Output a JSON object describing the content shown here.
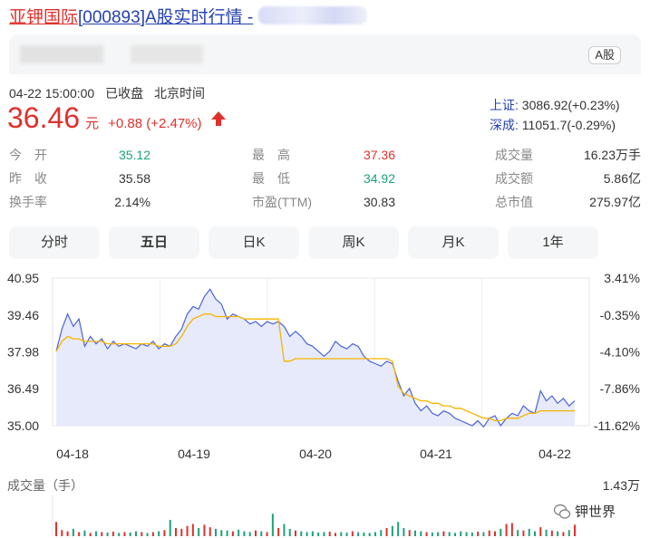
{
  "title": {
    "name": "亚钾国际",
    "rest": "[000893]A股实时行情 -"
  },
  "header": {
    "badge": "A股"
  },
  "status": {
    "datetime": "04-22 15:00:00",
    "state": "已收盘",
    "tz": "北京时间"
  },
  "price": {
    "current": "36.46",
    "unit": "元",
    "change": "+0.88 (+2.47%)"
  },
  "indexes": [
    {
      "label": "上证:",
      "value": "3086.92(+0.23%)"
    },
    {
      "label": "深成:",
      "value": "11051.7(-0.29%)"
    }
  ],
  "stats": [
    [
      {
        "label": "今　开",
        "value": "35.12",
        "color": "#1aa37a"
      },
      {
        "label": "最　高",
        "value": "37.36",
        "color": "#e0302c"
      },
      {
        "label": "成交量",
        "value": "16.23万手",
        "color": "#333333"
      }
    ],
    [
      {
        "label": "昨　收",
        "value": "35.58",
        "color": "#333333"
      },
      {
        "label": "最　低",
        "value": "34.92",
        "color": "#1aa37a"
      },
      {
        "label": "成交额",
        "value": "5.86亿",
        "color": "#333333"
      }
    ],
    [
      {
        "label": "换手率",
        "value": "2.14%",
        "color": "#333333"
      },
      {
        "label": "市盈(TTM)",
        "value": "30.83",
        "color": "#333333"
      },
      {
        "label": "总市值",
        "value": "275.97亿",
        "color": "#333333"
      }
    ]
  ],
  "tabs": [
    "分时",
    "五日",
    "日K",
    "周K",
    "月K",
    "1年"
  ],
  "active_tab": 1,
  "chart_data": {
    "type": "line",
    "y_ticks": [
      "40.95",
      "39.46",
      "37.98",
      "36.49",
      "35.00"
    ],
    "y_tick_values": [
      40.95,
      39.46,
      37.98,
      36.49,
      35.0
    ],
    "pct_ticks": [
      "3.41%",
      "-0.35%",
      "-4.10%",
      "-7.86%",
      "-11.62%"
    ],
    "x_ticks": [
      "04-18",
      "04-19",
      "04-20",
      "04-21",
      "04-22"
    ],
    "ylim": [
      35.0,
      40.95
    ],
    "series": [
      {
        "values": [
          38.0,
          38.9,
          39.5,
          39.0,
          39.3,
          38.2,
          38.6,
          38.3,
          38.5,
          38.1,
          38.4,
          38.2,
          38.3,
          38.2,
          38.1,
          38.3,
          38.2,
          38.4,
          38.1,
          38.3,
          38.2,
          38.6,
          38.9,
          39.5,
          39.8,
          39.7,
          40.2,
          40.5,
          40.1,
          39.9,
          39.3,
          39.5,
          39.4,
          39.3,
          39.1,
          39.2,
          39.0,
          39.2,
          39.1,
          39.2,
          39.0,
          38.6,
          38.8,
          38.6,
          38.3,
          38.2,
          38.0,
          37.8,
          38.0,
          38.4,
          38.2,
          38.1,
          38.3,
          38.2,
          37.8,
          37.6,
          37.5,
          37.4,
          37.6,
          37.5,
          36.8,
          36.2,
          36.5,
          35.9,
          35.6,
          35.8,
          35.5,
          35.4,
          35.6,
          35.5,
          35.3,
          35.2,
          35.1,
          35.0,
          35.2,
          34.95,
          35.3,
          35.4,
          35.0,
          35.3,
          35.5,
          35.4,
          35.8,
          35.6,
          35.5,
          36.4,
          36.0,
          36.2,
          35.9,
          36.1,
          35.8,
          36.0
        ]
      },
      {
        "values": [
          38.0,
          38.4,
          38.6,
          38.5,
          38.5,
          38.4,
          38.4,
          38.4,
          38.4,
          38.3,
          38.3,
          38.3,
          38.3,
          38.3,
          38.3,
          38.3,
          38.3,
          38.3,
          38.2,
          38.2,
          38.2,
          38.3,
          38.6,
          39.0,
          39.3,
          39.4,
          39.5,
          39.5,
          39.4,
          39.4,
          39.4,
          39.4,
          39.4,
          39.3,
          39.3,
          39.3,
          39.3,
          39.3,
          39.3,
          39.3,
          37.6,
          37.6,
          37.7,
          37.7,
          37.7,
          37.7,
          37.7,
          37.7,
          37.7,
          37.7,
          37.7,
          37.7,
          37.7,
          37.7,
          37.7,
          37.7,
          37.7,
          37.7,
          37.7,
          37.6,
          36.6,
          36.3,
          36.2,
          36.1,
          36.0,
          36.0,
          35.9,
          35.9,
          35.8,
          35.8,
          35.7,
          35.7,
          35.6,
          35.5,
          35.4,
          35.3,
          35.3,
          35.2,
          35.2,
          35.3,
          35.3,
          35.3,
          35.4,
          35.5,
          35.5,
          35.6,
          35.6,
          35.6,
          35.6,
          35.6,
          35.6,
          35.6
        ]
      }
    ],
    "colors": {
      "price": "#4b63d6",
      "avg": "#f5b400",
      "fill": "#e4e8fa",
      "up": "#e0302c",
      "down": "#1aa37a"
    },
    "volume": {
      "label": "成交量（手）",
      "max_label": "1.43万",
      "values": [
        0.35,
        0.15,
        0.12,
        0.18,
        0.1,
        0.14,
        0.08,
        0.12,
        0.1,
        0.09,
        0.11,
        0.08,
        0.1,
        0.09,
        0.12,
        0.1,
        0.08,
        0.1,
        0.12,
        0.15,
        0.4,
        0.2,
        0.18,
        0.25,
        0.3,
        0.2,
        0.28,
        0.22,
        0.18,
        0.15,
        0.14,
        0.12,
        0.16,
        0.12,
        0.1,
        0.14,
        0.12,
        0.1,
        0.55,
        0.2,
        0.3,
        0.18,
        0.14,
        0.12,
        0.1,
        0.12,
        0.09,
        0.1,
        0.11,
        0.08,
        0.1,
        0.09,
        0.12,
        0.1,
        0.09,
        0.08,
        0.1,
        0.15,
        0.2,
        0.25,
        0.35,
        0.2,
        0.15,
        0.14,
        0.12,
        0.1,
        0.09,
        0.1,
        0.12,
        0.1,
        0.08,
        0.12,
        0.1,
        0.09,
        0.11,
        0.1,
        0.14,
        0.12,
        0.18,
        0.3,
        0.32,
        0.15,
        0.14,
        0.18,
        0.12,
        0.22,
        0.16,
        0.14,
        0.12,
        0.1,
        0.15,
        0.28
      ]
    }
  },
  "watermark": "钾世界"
}
